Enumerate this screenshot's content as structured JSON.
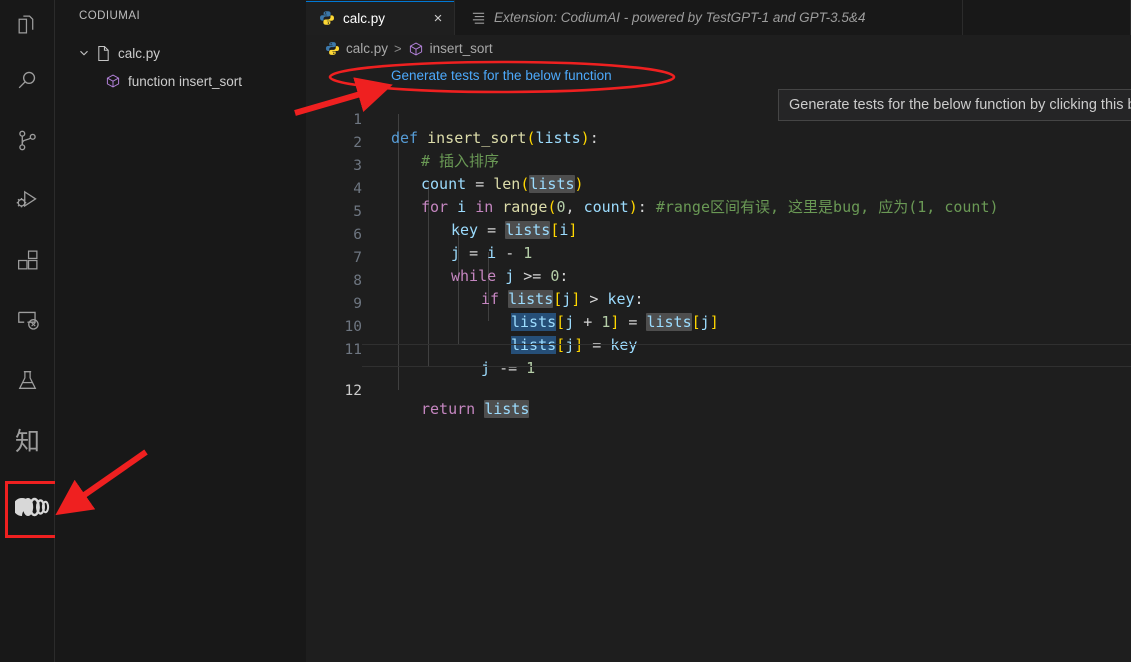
{
  "activitybar": {
    "items": [
      {
        "name": "explorer",
        "icon": "files-icon",
        "label": "Explorer"
      },
      {
        "name": "search",
        "icon": "search-icon",
        "label": "Search"
      },
      {
        "name": "source-control",
        "icon": "source-control-icon",
        "label": "Source Control"
      },
      {
        "name": "run-and-debug",
        "icon": "run-debug-icon",
        "label": "Run and Debug"
      },
      {
        "name": "extensions",
        "icon": "extensions-icon",
        "label": "Extensions"
      },
      {
        "name": "remote-explorer",
        "icon": "remote-explorer-icon",
        "label": "Remote Explorer"
      },
      {
        "name": "testing",
        "icon": "beaker-icon",
        "label": "Testing"
      },
      {
        "name": "chinese-ext",
        "icon": "zhi-character-icon",
        "label": "知"
      },
      {
        "name": "codiumai",
        "icon": "codiumai-logo-icon",
        "label": "CodiumAI"
      }
    ],
    "highlight_color": "#ef2020"
  },
  "sidebar": {
    "title": "CODIUMAI",
    "tree": [
      {
        "label": "calc.py",
        "icon": "python-file-icon",
        "expanded": true,
        "twisty": "chevron-down-icon"
      },
      {
        "label": "function insert_sort",
        "icon": "symbol-method-icon",
        "expanded": false
      }
    ]
  },
  "tabs": [
    {
      "label": "calc.py",
      "icon": "python-icon",
      "active": true,
      "close": "×",
      "italic": false
    },
    {
      "label": "Extension: CodiumAI - powered by TestGPT-1 and GPT-3.5&4",
      "icon": "extension-icon",
      "active": false,
      "italic": true
    }
  ],
  "breadcrumb": {
    "file": "calc.py",
    "separator": ">",
    "symbol": "insert_sort",
    "file_icon": "python-icon",
    "symbol_icon": "symbol-method-icon"
  },
  "codelens": {
    "label": "Generate tests for the below function"
  },
  "tooltip": {
    "text": "Generate tests for the below function by clicking this button"
  },
  "code": {
    "lines": [
      {
        "n": "1",
        "text": "def insert_sort(lists):"
      },
      {
        "n": "2",
        "text": "    # 插入排序"
      },
      {
        "n": "3",
        "text": "    count = len(lists)"
      },
      {
        "n": "4",
        "text": "    for i in range(0, count): #range区间有误, 这里是bug, 应为(1, count)"
      },
      {
        "n": "5",
        "text": "        key = lists[i]"
      },
      {
        "n": "6",
        "text": "        j = i - 1"
      },
      {
        "n": "7",
        "text": "        while j >= 0:"
      },
      {
        "n": "8",
        "text": "            if lists[j] > key:"
      },
      {
        "n": "9",
        "text": "                lists[j + 1] = lists[j]"
      },
      {
        "n": "10",
        "text": "                lists[j] = key"
      },
      {
        "n": "11",
        "text": "            j -= 1"
      },
      {
        "n": "12",
        "text": "    return lists"
      }
    ],
    "active_line": "12"
  },
  "colors": {
    "editor_background": "#1e1e1e",
    "sidebar_background": "#181818",
    "codelens_link": "#4daafc",
    "annotation_red": "#ef2020",
    "selection_blue": "#264f78",
    "word_highlight": "#4e4e4e"
  }
}
